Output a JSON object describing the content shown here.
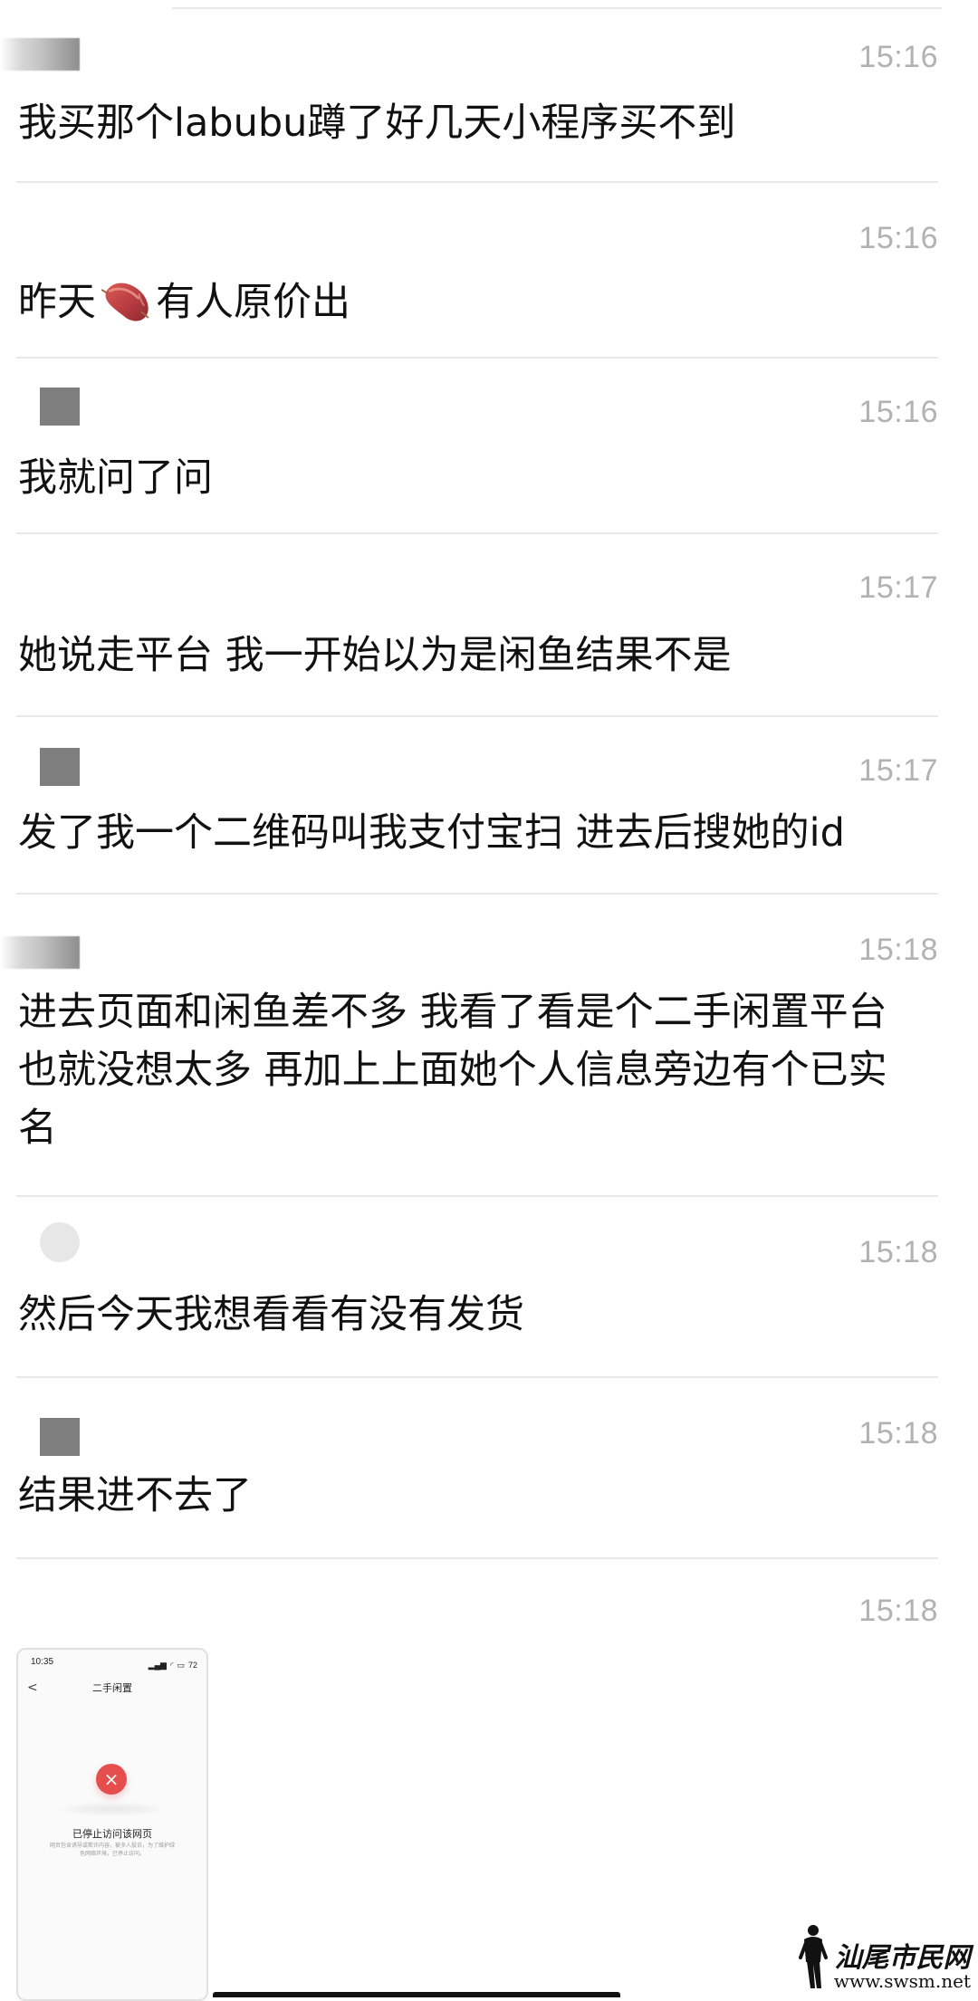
{
  "messages": [
    {
      "time": "15:16",
      "text": "我买那个labubu蹲了好几天小程序买不到"
    },
    {
      "time": "15:16",
      "text_before": "昨天",
      "emoji": "sweet-potato-icon",
      "text_after": "有人原价出"
    },
    {
      "time": "15:16",
      "text": "我就问了问"
    },
    {
      "time": "15:17",
      "text": "她说走平台 我一开始以为是闲鱼结果不是"
    },
    {
      "time": "15:17",
      "text": "发了我一个二维码叫我支付宝扫 进去后搜她的id"
    },
    {
      "time": "15:18",
      "text": "进去页面和闲鱼差不多 我看了看是个二手闲置平台也就没想太多 再加上上面她个人信息旁边有个已实名"
    },
    {
      "time": "15:18",
      "text": "然后今天我想看看有没有发货"
    },
    {
      "time": "15:18",
      "text": "结果进不去了"
    },
    {
      "time": "15:18"
    }
  ],
  "screenshot": {
    "status_time": "10:35",
    "battery": "72",
    "back": "<",
    "page_title": "二手闲置",
    "error_icon": "close-icon",
    "error_title": "已停止访问该网页",
    "error_desc": "网页包含诱导或欺诈内容，被多人投诉，为了维护绿色网络环境，已停止访问。"
  },
  "watermark": {
    "title": "汕尾市民网",
    "url": "www.swsm.net"
  },
  "colors": {
    "background": "#ffffff",
    "text": "#111111",
    "timestamp": "#b2b2b2",
    "divider": "#e8e8e8",
    "error": "#e64d4d"
  }
}
